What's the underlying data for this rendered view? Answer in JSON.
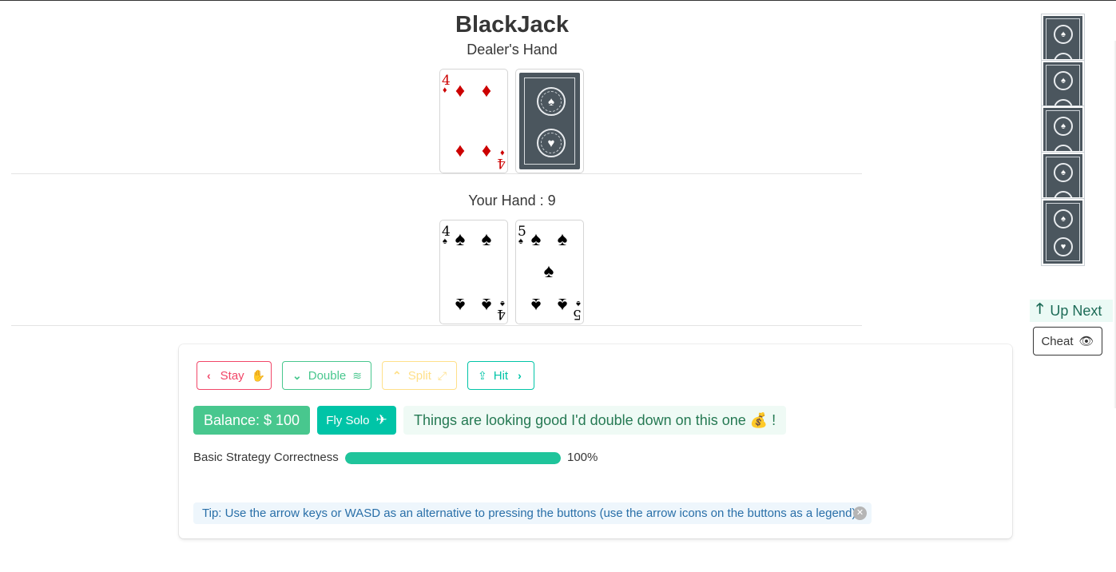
{
  "header": {
    "title": "BlackJack",
    "dealer_label": "Dealer's Hand",
    "player_label": "Your Hand : 9"
  },
  "dealer": {
    "cards": [
      {
        "rank": "4",
        "suit": "diamonds",
        "suit_glyph": "♦",
        "face_up": true
      },
      {
        "face_up": false
      }
    ]
  },
  "player": {
    "total": 9,
    "cards": [
      {
        "rank": "4",
        "suit": "spades",
        "suit_glyph": "♠",
        "face_up": true
      },
      {
        "rank": "5",
        "suit": "spades",
        "suit_glyph": "♠",
        "face_up": true
      }
    ]
  },
  "side": {
    "up_next_label": "Up Next",
    "cheat_label": "Cheat",
    "deck_visible_cards": 5
  },
  "actions": {
    "stay": {
      "label": "Stay",
      "left_icon": "chevron-left-icon",
      "right_icon": "hand-icon",
      "color": "#f14668"
    },
    "double": {
      "label": "Double",
      "left_icon": "chevron-down-icon",
      "right_icon": "coins-icon",
      "color": "#48c78e"
    },
    "split": {
      "label": "Split",
      "left_icon": "chevron-up-icon",
      "right_icon": "expand-icon",
      "color": "#ffe08a",
      "disabled": true
    },
    "hit": {
      "label": "Hit",
      "left_icon": "hand-holding-icon",
      "right_icon": "chevron-right-icon",
      "color": "#00c4a7"
    }
  },
  "status": {
    "balance_label": "Balance: $ 100",
    "fly_solo_label": "Fly Solo",
    "advice": "Things are looking good I'd double down on this one 💰 !",
    "strategy_label": "Basic Strategy Correctness",
    "strategy_pct": 100,
    "strategy_pct_label": "100%",
    "tip": "Tip: Use the arrow keys or WASD as an alternative to pressing the buttons (use the arrow icons on the buttons as a legend)"
  },
  "colors": {
    "card_back": "#4b565e",
    "red_suit": "#cc0000",
    "balance": "#48c78e",
    "fly_solo": "#00c4a7",
    "progress": "#1fc49b"
  }
}
